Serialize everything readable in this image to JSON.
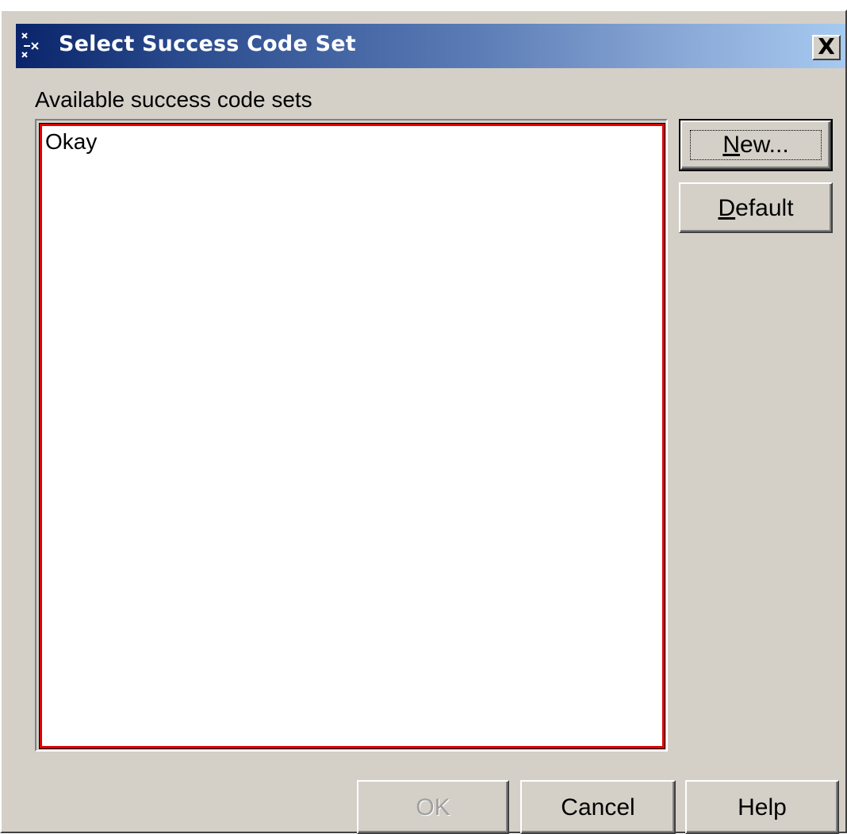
{
  "window": {
    "title": "Select Success Code Set",
    "close_label": "X"
  },
  "list": {
    "label": "Available success code sets",
    "items": [
      {
        "label": "Okay",
        "selected": false
      }
    ]
  },
  "side_buttons": {
    "new_label": "New...",
    "default_label": "Default"
  },
  "footer_buttons": {
    "ok_label": "OK",
    "ok_enabled": false,
    "cancel_label": "Cancel",
    "help_label": "Help"
  },
  "colors": {
    "titlebar_start": "#0a246a",
    "titlebar_end": "#a6caf0",
    "face": "#d4d0c8",
    "list_focus_border": "#e00000"
  },
  "icons": {
    "title": "app-window-icon",
    "close": "close-icon"
  }
}
